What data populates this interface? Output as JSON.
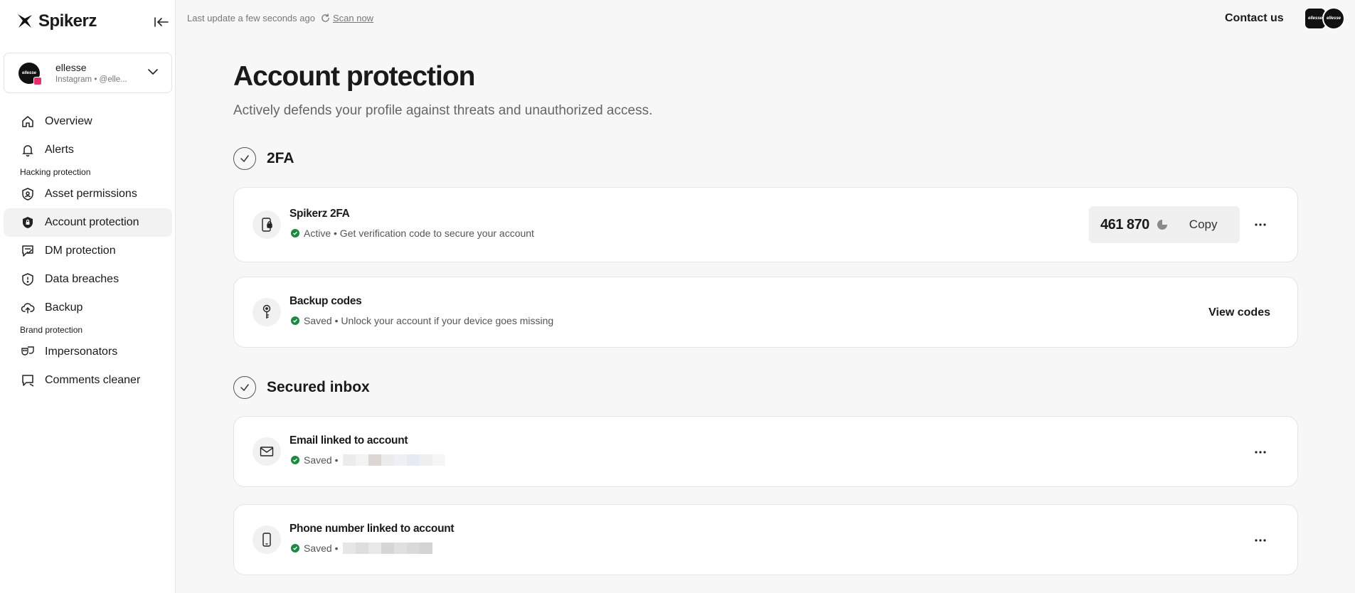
{
  "brand": {
    "name": "Spikerz"
  },
  "account": {
    "name": "ellesse",
    "sub": "Instagram • @elle...",
    "avatar_text": "ellesse"
  },
  "nav": {
    "overview": "Overview",
    "alerts": "Alerts",
    "section_hacking": "Hacking protection",
    "asset_permissions": "Asset permissions",
    "account_protection": "Account protection",
    "dm_protection": "DM protection",
    "data_breaches": "Data breaches",
    "backup": "Backup",
    "section_brand": "Brand protection",
    "impersonators": "Impersonators",
    "comments_cleaner": "Comments cleaner"
  },
  "topbar": {
    "last_update": "Last update a few seconds ago",
    "scan_now": "Scan now",
    "contact_us": "Contact us"
  },
  "page": {
    "title": "Account protection",
    "subtitle": "Actively defends your profile against threats and unauthorized access."
  },
  "sections": {
    "twofa": {
      "title": "2FA",
      "spikerz": {
        "title": "Spikerz 2FA",
        "status": "Active • Get verification code to secure your account",
        "code": "461 870",
        "copy_label": "Copy"
      },
      "backup": {
        "title": "Backup codes",
        "status": "Saved • Unlock your account if your device goes missing",
        "view_label": "View codes"
      }
    },
    "inbox": {
      "title": "Secured inbox",
      "email": {
        "title": "Email linked to account",
        "status": "Saved •"
      },
      "phone": {
        "title": "Phone number linked to account",
        "status": "Saved •"
      }
    }
  },
  "colors": {
    "status_ok": "#1c8a3e",
    "instagram": "#e1306c"
  }
}
